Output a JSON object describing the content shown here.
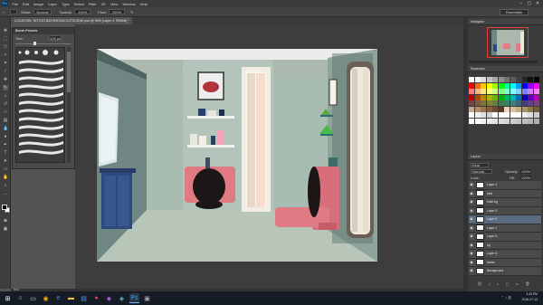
{
  "menu": {
    "logo": "Ps",
    "items": [
      "File",
      "Edit",
      "Image",
      "Layer",
      "Type",
      "Select",
      "Filter",
      "3D",
      "View",
      "Window",
      "Help"
    ]
  },
  "options": {
    "mode_label": "Mode:",
    "mode_value": "Normal",
    "opacity_label": "Opacity:",
    "opacity_value": "100%",
    "flow_label": "Flow:",
    "flow_value": "100%",
    "workspace": "Essentials"
  },
  "document": {
    "tab_title": "LOCATION: TATTOO BATHROOM CUTSCENE.psd @ 50% (Layer 2, RGB/8) *",
    "status": "50%"
  },
  "brush_panel": {
    "title": "Brush Presets",
    "size_label": "Size:",
    "size_value": "125 px"
  },
  "panels": {
    "navigator": "Navigator",
    "swatches": "Swatches",
    "layers": "Layers"
  },
  "layers": {
    "kind_label": "Kind",
    "blend": "Normal",
    "opacity_label": "Opacity:",
    "opacity_value": "100%",
    "lock_label": "Lock:",
    "fill_label": "Fill:",
    "fill_value": "100%",
    "rows": [
      {
        "name": "Layer 4",
        "selected": false
      },
      {
        "name": "sink",
        "selected": false
      },
      {
        "name": "toilet bg",
        "selected": false
      },
      {
        "name": "Layer 3",
        "selected": false
      },
      {
        "name": "Layer 2",
        "selected": true
      },
      {
        "name": "Layer 1",
        "selected": false
      },
      {
        "name": "Layer 5",
        "selected": false
      },
      {
        "name": "bg",
        "selected": false
      },
      {
        "name": "Layer 6",
        "selected": false
      },
      {
        "name": "frame",
        "selected": false
      },
      {
        "name": "Background",
        "selected": false
      }
    ]
  },
  "taskbar": {
    "time": "3:43 PM",
    "date": "2016-07-13"
  },
  "colors": {
    "app_bg": "#535353",
    "panel_bg": "#3b3b3b",
    "wall": "#aab8ae",
    "toilet": "#e07a83",
    "cabinet": "#2d4a7e",
    "selection_accent": "#5c6c80"
  },
  "swatch_colors": [
    "#ffffff",
    "#f3f3f3",
    "#dddddd",
    "#c3c3c3",
    "#a9a9a9",
    "#8e8e8e",
    "#737373",
    "#5a5a5a",
    "#404040",
    "#262626",
    "#111111",
    "#000000",
    "#ff0000",
    "#ff6600",
    "#ffcc00",
    "#ffff00",
    "#99ff00",
    "#00ff00",
    "#00ff99",
    "#00ffff",
    "#0099ff",
    "#0000ff",
    "#9900ff",
    "#ff00ff",
    "#ff7f7f",
    "#ffb27f",
    "#ffe57f",
    "#ffff7f",
    "#ccff7f",
    "#7fff7f",
    "#7fffcc",
    "#7fffff",
    "#7fccff",
    "#7f7fff",
    "#cc7fff",
    "#ff7fff",
    "#b20000",
    "#b24700",
    "#b28e00",
    "#b2b200",
    "#6bb200",
    "#00b200",
    "#00b26b",
    "#00b2b2",
    "#006bb2",
    "#0000b2",
    "#6b00b2",
    "#b200b2",
    "#7f3f3f",
    "#7f5a3f",
    "#7f723f",
    "#7f7f3f",
    "#667f3f",
    "#3f7f3f",
    "#3f7f66",
    "#3f7f7f",
    "#3f667f",
    "#3f3f7f",
    "#663f7f",
    "#7f3f7f",
    "#c9a98a",
    "#b58c66",
    "#9e7352",
    "#866042",
    "#6e4d35",
    "#57392a",
    "#e8d4b8",
    "#d6c19a",
    "#c3ab80",
    "#aa9166",
    "#8f774e",
    "#735e3a",
    "#ffffff",
    "#f0f0f0",
    "#e0e0e0",
    "#d0d0d0",
    "#ffffff",
    "#ffffff",
    "#ffffff",
    "#ffffff",
    "#ffffff",
    "#eeeeee",
    "#dddddd",
    "#cccccc",
    "#ffffff",
    "#fafafa",
    "#f2f2f2",
    "#ebebeb",
    "#e3e3e3",
    "#dcdcdc",
    "#d4d4d4",
    "#cdcdcd",
    "#c5c5c5",
    "#bebebe",
    "#b6b6b6",
    "#afafaf"
  ]
}
